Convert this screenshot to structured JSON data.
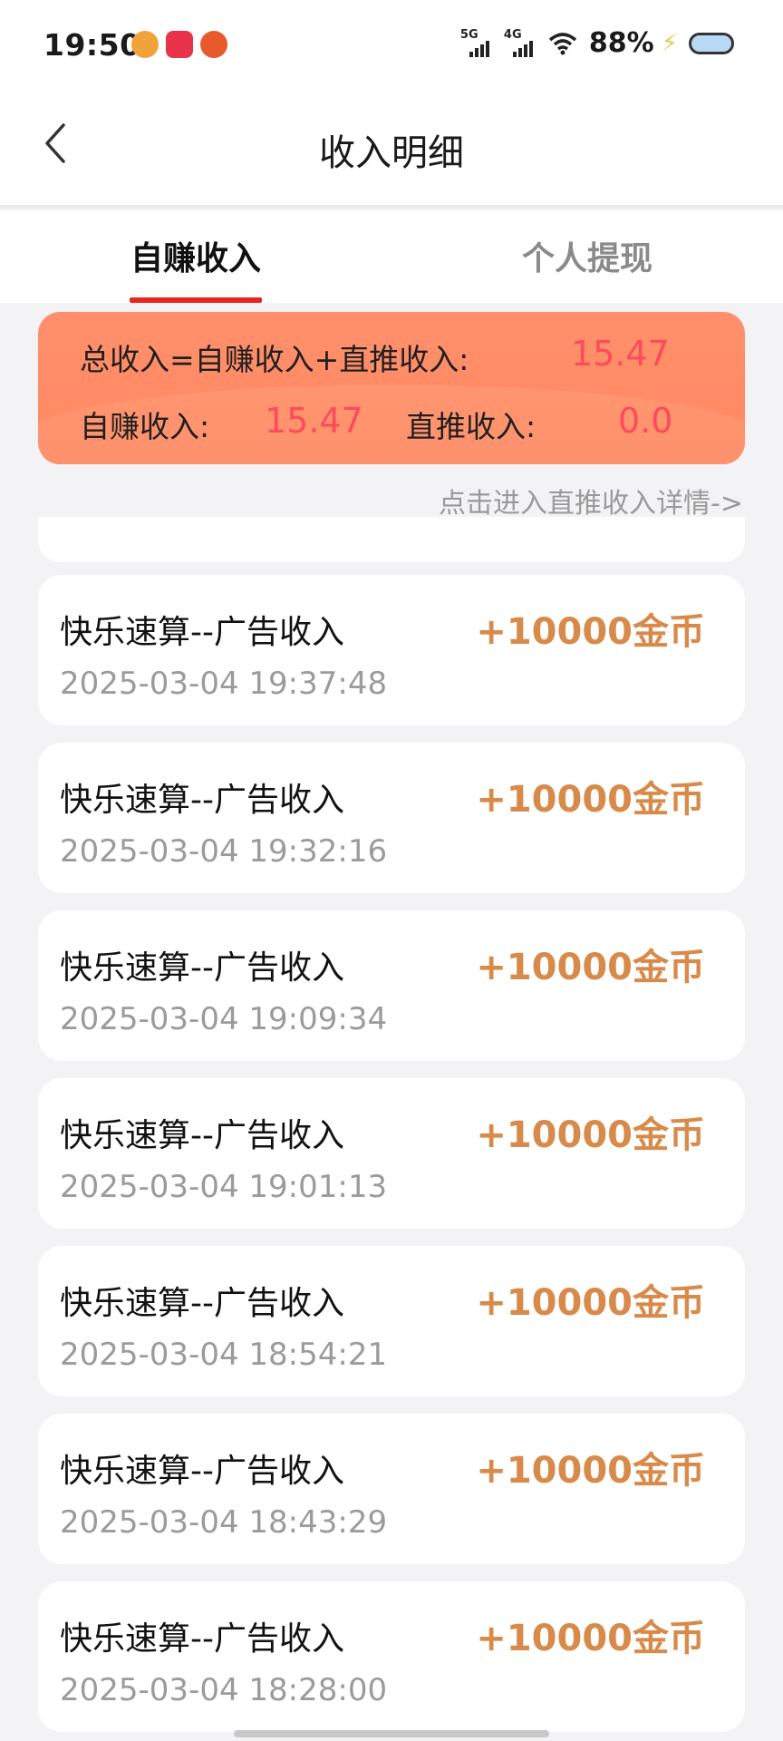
{
  "status_bar": {
    "time": "19:50",
    "app_icons": [
      "app-icon-1",
      "app-icon-2",
      "app-icon-3"
    ],
    "signal1_label": "5G",
    "signal2_label": "4G",
    "battery_percent": "88%"
  },
  "nav": {
    "title": "收入明细",
    "back_icon": "chevron-left-icon"
  },
  "tabs": {
    "active": "自赚收入",
    "inactive": "个人提现"
  },
  "summary": {
    "total_label": "总收入=自赚收入+直推收入:",
    "total_value": "15.47",
    "self_label": "自赚收入:",
    "self_value": "15.47",
    "direct_label": "直推收入:",
    "direct_value": "0.0",
    "direct_link": "点击进入直推收入详情->"
  },
  "records": [
    {
      "title": "快乐速算--广告收入",
      "amount": "+10000金币",
      "time": "2025-03-04 19:37:48"
    },
    {
      "title": "快乐速算--广告收入",
      "amount": "+10000金币",
      "time": "2025-03-04 19:32:16"
    },
    {
      "title": "快乐速算--广告收入",
      "amount": "+10000金币",
      "time": "2025-03-04 19:09:34"
    },
    {
      "title": "快乐速算--广告收入",
      "amount": "+10000金币",
      "time": "2025-03-04 19:01:13"
    },
    {
      "title": "快乐速算--广告收入",
      "amount": "+10000金币",
      "time": "2025-03-04 18:54:21"
    },
    {
      "title": "快乐速算--广告收入",
      "amount": "+10000金币",
      "time": "2025-03-04 18:43:29"
    },
    {
      "title": "快乐速算--广告收入",
      "amount": "+10000金币",
      "time": "2025-03-04 18:28:00"
    }
  ],
  "colors": {
    "accent_red": "#e8251f",
    "summary_card": "#ff8c66",
    "summary_value": "#ff4a5a",
    "amount": "#d88a4a",
    "secondary_text": "#9b9b9b"
  }
}
